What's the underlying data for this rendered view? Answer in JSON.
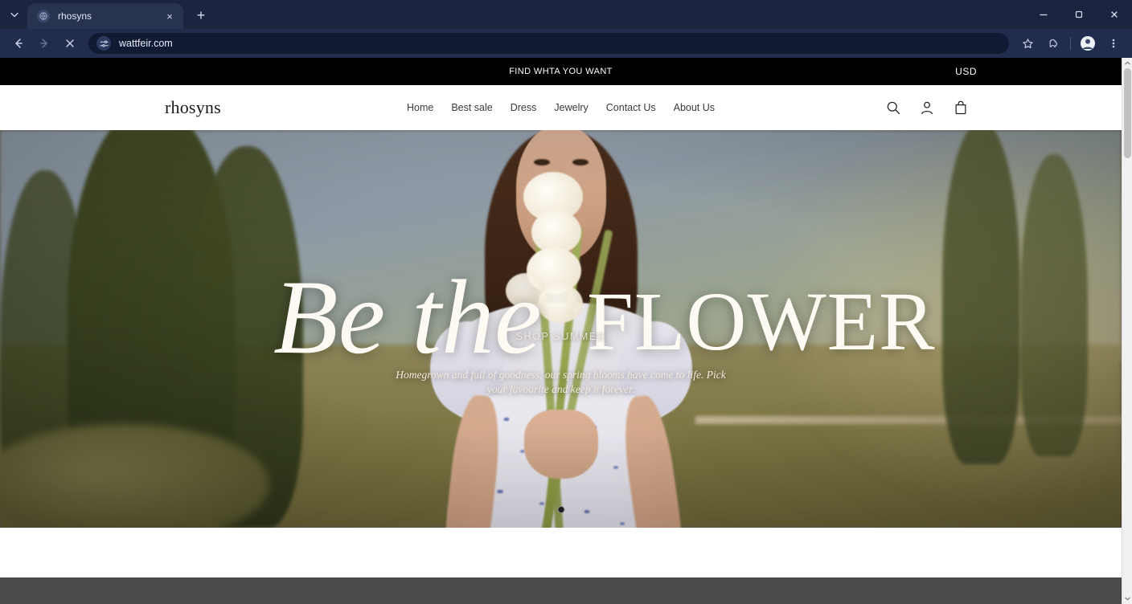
{
  "browser": {
    "tab": {
      "title": "rhosyns",
      "favicon": "globe-icon",
      "close": "×"
    },
    "new_tab_label": "+",
    "tab_list_label": "⌄",
    "window": {
      "minimize": "−",
      "maximize": "□",
      "close": "✕"
    },
    "nav": {
      "back": "←",
      "forward": "→",
      "stop": "✕"
    },
    "omnibox": {
      "url": "wattfeir.com",
      "site_settings_icon": "tune-icon"
    },
    "actions": {
      "bookmark": "☆",
      "extensions": "puzzle-icon",
      "profile": "avatar-icon",
      "menu": "⋮"
    }
  },
  "site": {
    "announcement": {
      "text": "FIND WHTA YOU WANT",
      "currency": "USD"
    },
    "logo": "rhosyns",
    "nav": [
      {
        "label": "Home"
      },
      {
        "label": "Best sale"
      },
      {
        "label": "Dress"
      },
      {
        "label": "Jewelry"
      },
      {
        "label": "Contact Us"
      },
      {
        "label": "About Us"
      }
    ],
    "header_icons": [
      {
        "name": "search-icon"
      },
      {
        "name": "account-icon"
      },
      {
        "name": "cart-icon"
      }
    ],
    "hero": {
      "headline_script": "Be the",
      "headline_roman": "FLOWER",
      "cta": "SHOP SUMMER",
      "subtitle": "Homegrown and full of goodness, our spring blooms have come to life. Pick your favourite and keep it forever.",
      "slide_count": 1,
      "active_slide": 1
    }
  },
  "colors": {
    "announcement_bg": "#000000",
    "header_bg": "#ffffff",
    "text_dark": "#1a1a1a",
    "hero_text": "#fdfaf4",
    "footer_band": "#4a4a4a",
    "browser_chrome": "#1b2540"
  }
}
